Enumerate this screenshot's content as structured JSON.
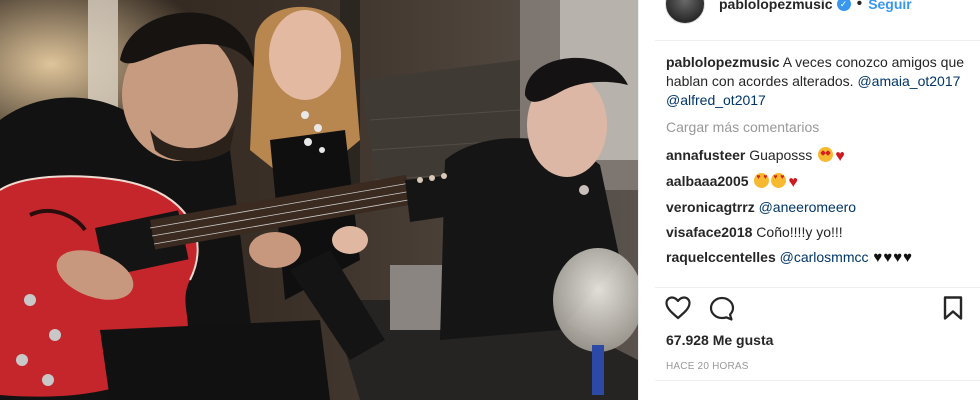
{
  "post": {
    "username": "pablolopezmusic",
    "follow_label": "Seguir",
    "caption_user": "pablolopezmusic",
    "caption_text": " A veces conozco amigos que hablan con acordes alterados. ",
    "caption_mention_1": "@amaia_ot2017",
    "caption_mention_2": "@alfred_ot2017",
    "load_more": "Cargar más comentarios",
    "likes": "67.928 Me gusta",
    "timestamp": "HACE 20 HORAS"
  },
  "comments": [
    {
      "user": "annafusteer",
      "text": " Guaposss",
      "emojis": [
        "star-eyes",
        "heart"
      ]
    },
    {
      "user": "aalbaaa2005",
      "text": " ",
      "emojis": [
        "heart-eyes",
        "heart-eyes",
        "heart"
      ]
    },
    {
      "user": "veronicagtrrz",
      "text": " ",
      "mention": "@aneeromeero"
    },
    {
      "user": "visaface2018",
      "text": " Coño!!!!y yo!!!"
    },
    {
      "user": "raquelccentelles",
      "text": " ",
      "mention": "@carlosmmcc",
      "emojis": [
        "black-heart",
        "black-heart",
        "black-heart",
        "black-heart"
      ]
    }
  ],
  "icons": {
    "like": "heart-outline-icon",
    "comment": "speech-bubble-icon",
    "save": "bookmark-icon",
    "verified": "verified-check-icon"
  },
  "colors": {
    "link": "#003569",
    "follow": "#3897f0",
    "muted": "#999999",
    "guitar": "#c4262b"
  }
}
